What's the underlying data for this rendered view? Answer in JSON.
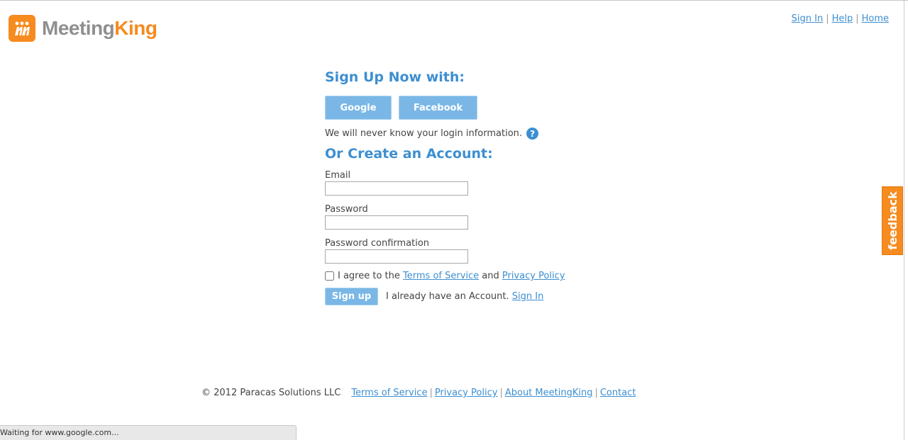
{
  "header": {
    "logo_mark": "m",
    "logo_text_1": "Meeting",
    "logo_text_2": "King",
    "nav": {
      "sign_in": "Sign In",
      "help": "Help",
      "home": "Home",
      "separator": "|"
    }
  },
  "signup": {
    "heading": "Sign Up Now with:",
    "google_label": "Google",
    "facebook_label": "Facebook",
    "note": "We will never know your login information.",
    "help_icon_glyph": "?",
    "create_heading": "Or Create an Account:",
    "fields": {
      "email_label": "Email",
      "email_value": "",
      "password_label": "Password",
      "password_value": "",
      "password_confirm_label": "Password confirmation",
      "password_confirm_value": ""
    },
    "agree": {
      "checked": false,
      "prefix": "I agree to the",
      "terms": "Terms of Service",
      "and": "and",
      "privacy": "Privacy Policy"
    },
    "submit_label": "Sign up",
    "existing_text": "I already have an Account.",
    "sign_in_link": "Sign In"
  },
  "footer": {
    "copyright": "© 2012 Paracas Solutions LLC",
    "links": {
      "terms": "Terms of Service",
      "privacy": "Privacy Policy",
      "about": "About MeetingKing",
      "contact": "Contact",
      "separator": "|"
    }
  },
  "feedback_tab": "feedback",
  "status_bar": "Waiting for www.google.com...",
  "colors": {
    "brand_orange": "#f68b1f",
    "link_blue": "#3d8fd1",
    "button_blue": "#7ab7e6",
    "logo_gray": "#8f8f8f"
  }
}
